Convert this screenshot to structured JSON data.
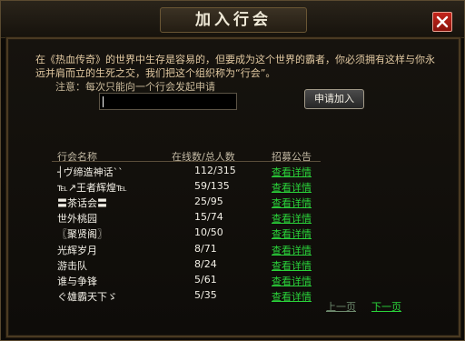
{
  "window": {
    "title": "加入行会",
    "close_icon": "close-icon",
    "accent": "#c4261c"
  },
  "intro": {
    "text": "在《热血传奇》的世界中生存是容易的，但要成为这个世界的霸者，你必须拥有这样与你永远并肩而立的生死之交，我们把这个组织称为“行会”。",
    "notice": "注意：每次只能向一个行会发起申请"
  },
  "apply": {
    "input_value": "",
    "button_label": "申请加入"
  },
  "table": {
    "headers": [
      "行会名称",
      "在线数/总人数",
      "招募公告"
    ],
    "link_color": "#2ad43a",
    "rows": [
      {
        "name": "┤ヴ缔造神话``",
        "count": "112/315",
        "link": "查看详情"
      },
      {
        "name": "℡↗王者辉煌℡",
        "count": "59/135",
        "link": "查看详情"
      },
      {
        "name": "〓茶话会〓",
        "count": "25/95",
        "link": "查看详情"
      },
      {
        "name": "世外桃园",
        "count": "15/74",
        "link": "查看详情"
      },
      {
        "name": "〖聚贤阁〗",
        "count": "10/50",
        "link": "查看详情"
      },
      {
        "name": "光辉岁月",
        "count": "8/71",
        "link": "查看详情"
      },
      {
        "name": "游击队",
        "count": "8/24",
        "link": "查看详情"
      },
      {
        "name": "谁与争锋",
        "count": "5/61",
        "link": "查看详情"
      },
      {
        "name": "ぐ雄霸天下ゞ",
        "count": "5/35",
        "link": "查看详情"
      }
    ]
  },
  "pagination": {
    "prev": "上一页",
    "next": "下一页"
  }
}
